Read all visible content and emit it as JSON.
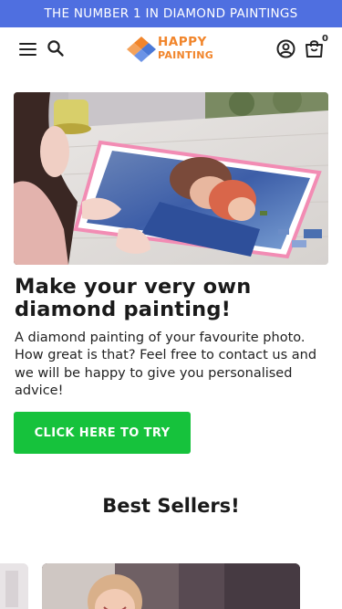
{
  "announcement": {
    "text": "THE NUMBER 1 IN DIAMOND PAINTINGS"
  },
  "header": {
    "logo_line1": "HAPPY",
    "logo_line2": "PAINTING",
    "cart_count": "0",
    "icons": [
      "menu-icon",
      "search-icon",
      "account-icon",
      "cart-icon"
    ]
  },
  "hero": {
    "headline": "Make your very own diamond painting!",
    "body": "A diamond painting of your favourite photo. How great is that? Feel free to contact us and we will be happy to give you personalised advice!",
    "cta_label": "CLICK HERE TO TRY"
  },
  "best_sellers": {
    "title": "Best Sellers!"
  },
  "colors": {
    "announcement_bg": "#4f6fe0",
    "cta_bg": "#16c23c",
    "logo_orange": "#f1852b",
    "logo_blue": "#4a78d6"
  }
}
